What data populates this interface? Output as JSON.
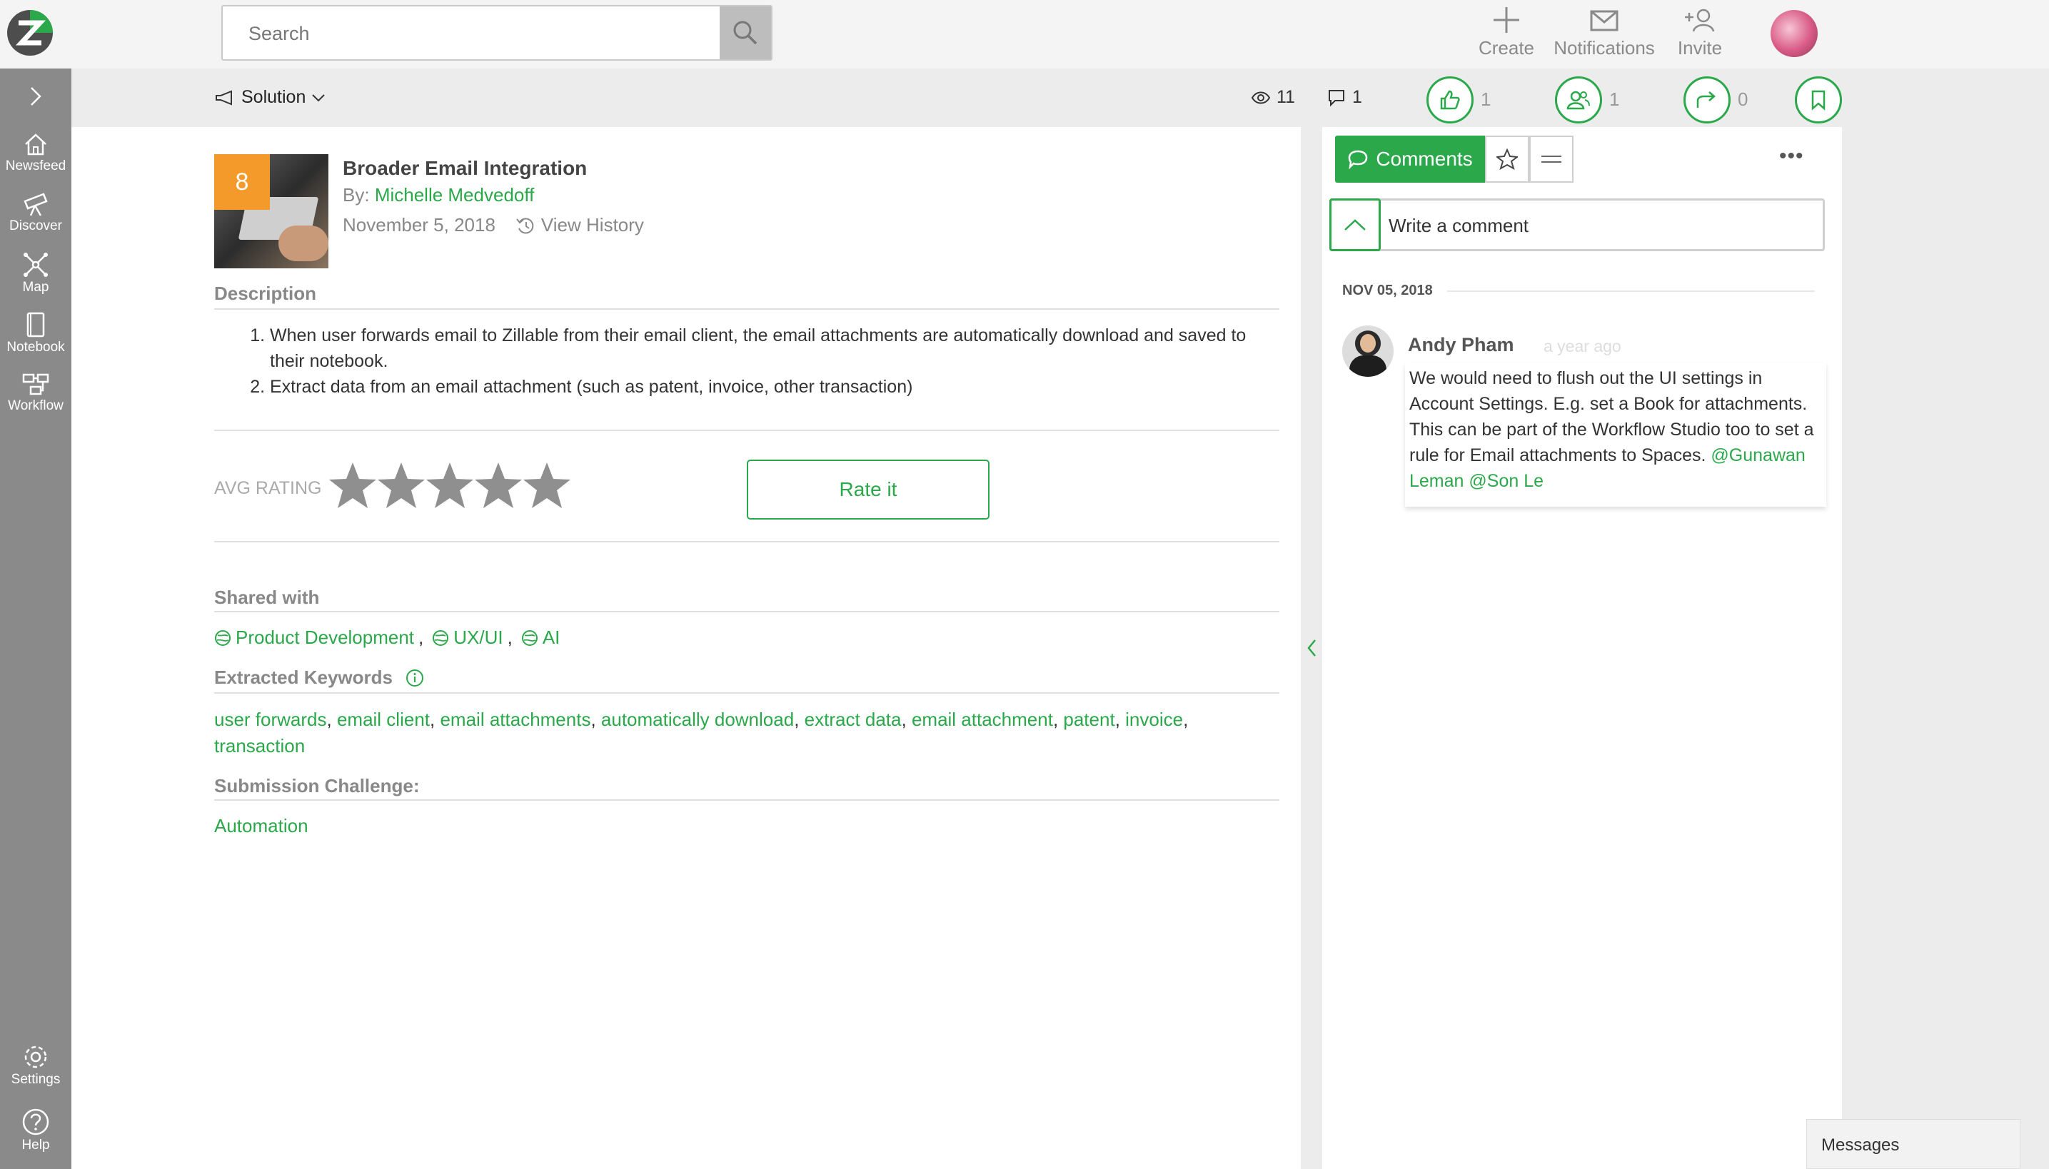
{
  "header": {
    "search_placeholder": "Search",
    "actions": [
      {
        "label": "Create",
        "icon": "plus-icon"
      },
      {
        "label": "Notifications",
        "icon": "envelope-icon"
      },
      {
        "label": "Invite",
        "icon": "add-user-icon"
      }
    ]
  },
  "sidebar": {
    "items": [
      {
        "label": "Newsfeed",
        "icon": "home-icon"
      },
      {
        "label": "Discover",
        "icon": "telescope-icon"
      },
      {
        "label": "Map",
        "icon": "network-icon"
      },
      {
        "label": "Notebook",
        "icon": "notebook-icon"
      },
      {
        "label": "Workflow",
        "icon": "workflow-icon"
      }
    ],
    "bottom": [
      {
        "label": "Settings",
        "icon": "gear-icon"
      },
      {
        "label": "Help",
        "icon": "help-icon"
      }
    ]
  },
  "subbar": {
    "type_label": "Solution",
    "views": "11",
    "comments": "1",
    "likes": "1",
    "endorse": "1",
    "shares": "0"
  },
  "idea": {
    "badge": "8",
    "title": "Broader Email Integration",
    "by_prefix": "By:",
    "author": "Michelle Medvedoff",
    "date": "November 5, 2018",
    "history_label": "View History",
    "description_title": "Description",
    "description": [
      "When user forwards email to Zillable from their email client, the email attachments are automatically download and saved to their notebook.",
      "Extract data from an email attachment (such as patent, invoice, other transaction)"
    ],
    "avg_rating_label": "AVG RATING",
    "rate_button": "Rate it",
    "shared_title": "Shared with",
    "shared": [
      "Product Development",
      "UX/UI",
      "AI"
    ],
    "keywords_title": "Extracted Keywords",
    "keywords": [
      "user forwards",
      "email client",
      "email attachments",
      "automatically download",
      "extract data",
      "email attachment",
      "patent",
      "invoice",
      "transaction"
    ],
    "challenge_title": "Submission Challenge:",
    "challenge": "Automation"
  },
  "comments": {
    "tab_label": "Comments",
    "write_placeholder": "Write a comment",
    "date_separator": "NOV 05, 2018",
    "items": [
      {
        "author": "Andy Pham",
        "time": "a year ago",
        "text": "We would need to flush out the UI settings in Account Settings. E.g. set a Book for attachments. This can be part of the Workflow Studio too to set a rule for Email attachments to Spaces.",
        "mentions": [
          "@Gunawan Leman",
          "@Son Le"
        ]
      }
    ]
  },
  "messages_label": "Messages",
  "colors": {
    "accent": "#2aa84a",
    "badge": "#f39a2a",
    "sidebar": "#8a8a8a"
  }
}
